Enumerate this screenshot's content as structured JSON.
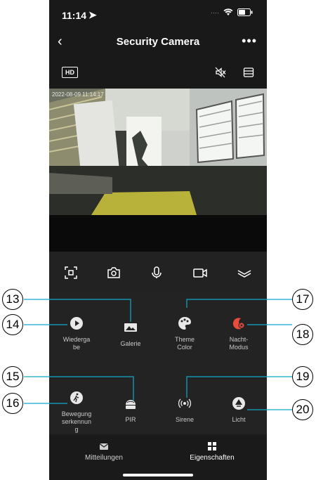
{
  "status": {
    "time": "11:14"
  },
  "nav": {
    "back": "‹",
    "title": "Security Camera",
    "more": "•••"
  },
  "video": {
    "hd_label": "HD",
    "timestamp": "2022-08-09 11:14:17"
  },
  "features": {
    "wiedergabe": "Wiederga be",
    "galerie": "Galerie",
    "theme_color": "Theme Color",
    "nacht_modus": "Nacht-Modus",
    "bewegungserkennung": "Bewegung serkennun g",
    "pir": "PIR",
    "sirene": "Sirene",
    "licht": "Licht"
  },
  "tabs": {
    "mitteilungen": "Mitteilungen",
    "eigenschaften": "Eigenschaften"
  },
  "callouts": [
    "13",
    "14",
    "15",
    "16",
    "17",
    "18",
    "19",
    "20"
  ],
  "colors": {
    "accent": "#e74c3c",
    "callout_line": "#12a9c8"
  }
}
